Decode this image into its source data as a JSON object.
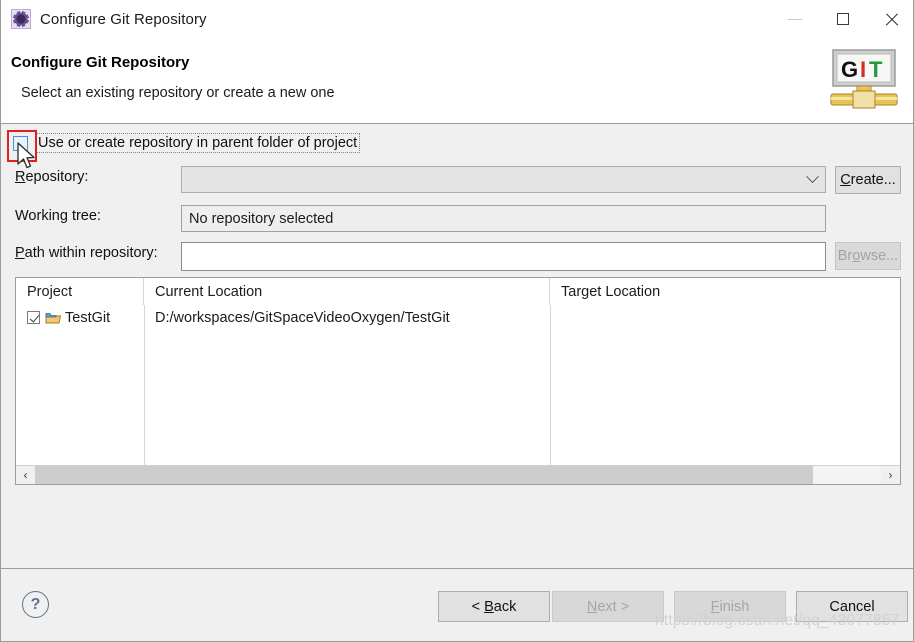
{
  "window": {
    "title": "Configure Git Repository",
    "icon": "gear-icon",
    "minimize_label": "–",
    "maximize_label": "□",
    "close_label": "✕"
  },
  "header": {
    "title": "Configure Git Repository",
    "subtitle": "Select an existing repository or create a new one",
    "logo_text": "GIT",
    "logo_letters": [
      "G",
      "I",
      "T"
    ],
    "logo_colors": [
      "#111111",
      "#d42a2a",
      "#1f9b3a"
    ]
  },
  "form": {
    "use_parent_checkbox": {
      "label": "Use or create repository in parent folder of project",
      "checked": false
    },
    "repository": {
      "label": "Repository:",
      "mnemonic": "R",
      "value": "",
      "enabled": false
    },
    "working_tree": {
      "label": "Working tree:",
      "value": "No repository selected"
    },
    "path_within_repository": {
      "label": "Path within repository:",
      "mnemonic": "P",
      "value": ""
    },
    "create_button": {
      "label": "Create...",
      "mnemonic": "C",
      "enabled": true
    },
    "browse_button": {
      "label": "Browse...",
      "mnemonic": "o",
      "enabled": false
    }
  },
  "table": {
    "columns": [
      "Project",
      "Current Location",
      "Target Location"
    ],
    "rows": [
      {
        "checked": true,
        "project": "TestGit",
        "current_location": "D:/workspaces/GitSpaceVideoOxygen/TestGit",
        "target_location": ""
      }
    ],
    "scroll_left_label": "‹",
    "scroll_right_label": "›"
  },
  "footer": {
    "help_label": "?",
    "buttons": [
      {
        "name": "back",
        "label": "< Back",
        "enabled": true
      },
      {
        "name": "next",
        "label": "Next >",
        "enabled": false
      },
      {
        "name": "finish",
        "label": "Finish",
        "enabled": false
      },
      {
        "name": "cancel",
        "label": "Cancel",
        "enabled": true
      }
    ]
  },
  "watermark": {
    "text": "https://blog.csdn.net/qq_43077857"
  },
  "colors": {
    "dialog_bg": "#f0f0f0",
    "accent_blue": "#4a90d9",
    "annotation_red": "#e02020",
    "text": "#111111"
  }
}
